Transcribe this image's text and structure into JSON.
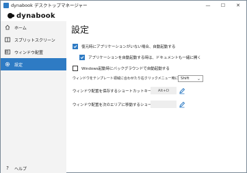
{
  "window": {
    "title": "dynabook デスクトップマネージャー",
    "controls": {
      "minimize": "—",
      "maximize": "☐",
      "close": "✕"
    }
  },
  "logo": {
    "text": "dynabook"
  },
  "sidebar": {
    "items": [
      {
        "label": "ホーム",
        "icon": "home-icon",
        "active": false
      },
      {
        "label": "スプリットスクリーン",
        "icon": "split-screen-icon",
        "active": false
      },
      {
        "label": "ウィンドウ配置",
        "icon": "window-layout-icon",
        "active": false
      },
      {
        "label": "設定",
        "icon": "gear-icon",
        "active": true
      }
    ],
    "help": {
      "label": "ヘルプ",
      "icon": "help-icon"
    }
  },
  "main": {
    "title": "設定",
    "options": {
      "auto_start": {
        "label": "復元時にアプリケーションがいない場合、自動起動する",
        "checked": true
      },
      "open_docs": {
        "label": "アプリケーションを自動起動する時は、ドキュメントも一緒に開く",
        "checked": true
      },
      "windows_startup": {
        "label": "Windows起動時にバックグラウンドで自動起動する",
        "checked": false
      }
    },
    "template_key": {
      "label": "ウィンドウをテンプレート領域に合わせたり右クリックメニュー時に使用するキー：",
      "value": "Shift"
    },
    "save_shortcut": {
      "label": "ウィンドウ配置を保存するショートカットキー：",
      "value": "Alt+D"
    },
    "move_shortcut": {
      "label": "ウィンドウ配置を次のエリアに移動するショートカットキー：",
      "value": ""
    }
  },
  "colors": {
    "accent": "#2e7bc4",
    "sidebar_bg": "#f3f3f3",
    "shortcut_bg": "#eeeeee"
  }
}
